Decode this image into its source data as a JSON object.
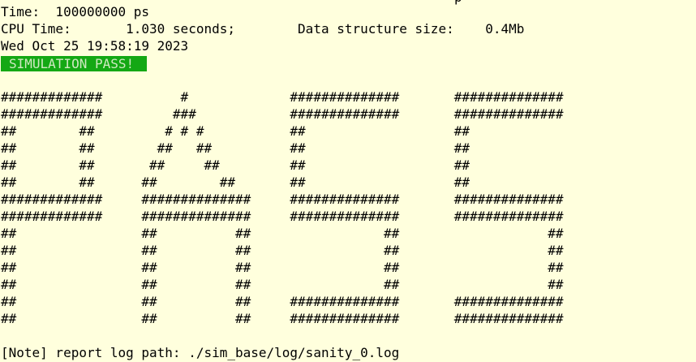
{
  "terminal": {
    "top_fragment": "p",
    "time_line": "Time:  100000000 ps",
    "cpu_line": "CPU Time:       1.030 seconds;        Data structure size:    0.4Mb",
    "date_line": "Wed Oct 25 19:58:19 2023",
    "status_badge": "SIMULATION PASS!",
    "status_color": "#14a814",
    "banner_rows": [
      "#############          #             ##############       ##############",
      "#############         ###            ##############       ##############",
      "##        ##         # # #           ##                   ##",
      "##        ##        ##   ##          ##                   ##",
      "##        ##       ##     ##         ##                   ##",
      "##        ##      ##        ##       ##                   ##",
      "#############     ##############     ##############       ##############",
      "#############     ##############     ##############       ##############",
      "##                ##          ##                 ##                   ##",
      "##                ##          ##                 ##                   ##",
      "##                ##          ##                 ##                   ##",
      "##                ##          ##                 ##                   ##",
      "##                ##          ##     ##############       ##############",
      "##                ##          ##     ##############       ##############"
    ],
    "note_line": "[Note] report log path: ./sim_base/log/sanity_0.log",
    "background_color": "#ffffdd"
  }
}
